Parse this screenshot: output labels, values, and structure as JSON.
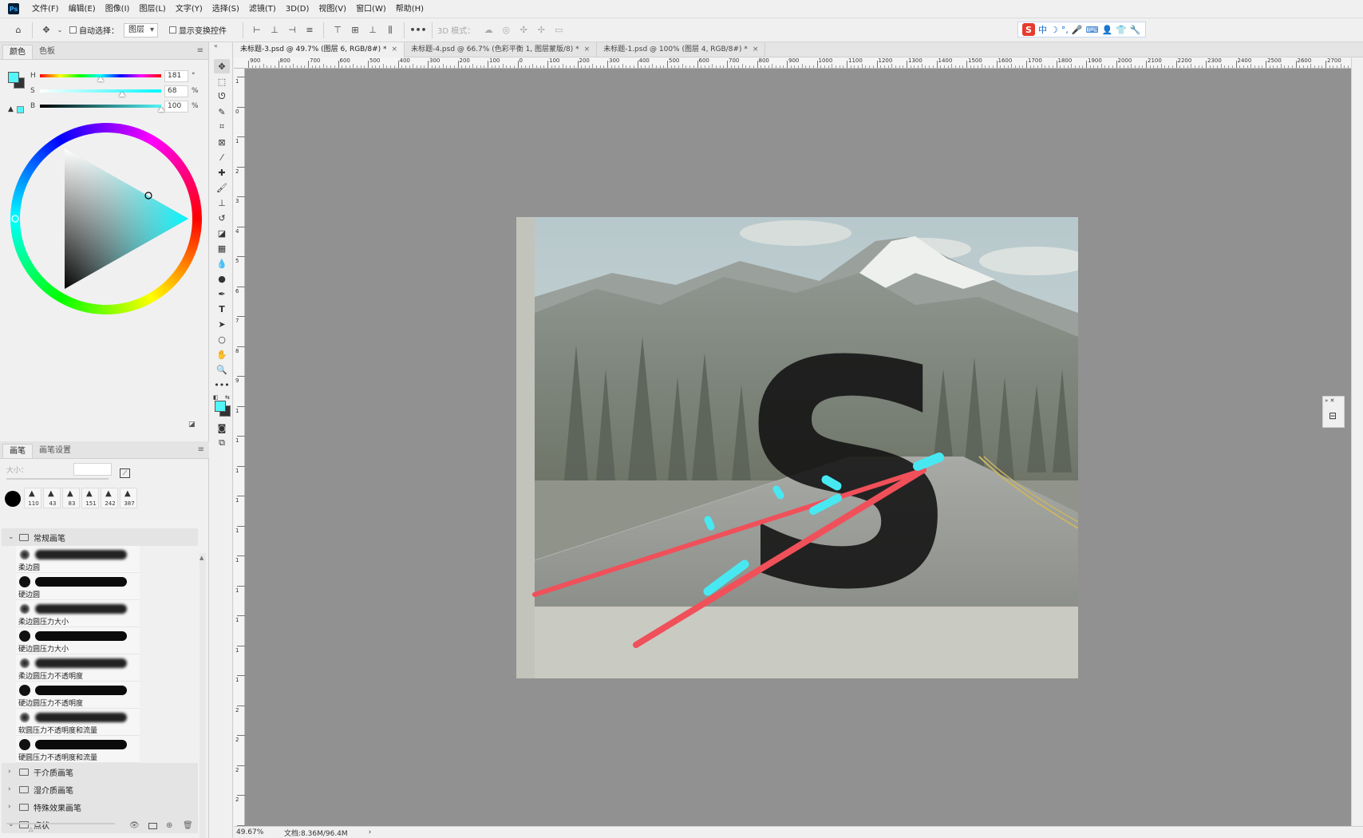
{
  "menu": {
    "items": [
      "文件(F)",
      "编辑(E)",
      "图像(I)",
      "图层(L)",
      "文字(Y)",
      "选择(S)",
      "滤镜(T)",
      "3D(D)",
      "视图(V)",
      "窗口(W)",
      "帮助(H)"
    ]
  },
  "options": {
    "auto_select_label": "自动选择：",
    "layer_select_value": "图层",
    "show_transform_label": "显示变换控件",
    "mode_3d_label": "3D 模式："
  },
  "ime": {
    "logo": "S",
    "labels": [
      "中",
      "☽",
      "°,",
      "🎤",
      "⌨",
      "👤",
      "👕",
      "🔧"
    ]
  },
  "color_panel": {
    "tabs": [
      "颜色",
      "色板"
    ],
    "h": {
      "label": "H",
      "value": "181",
      "unit": "°",
      "fraction": 0.5
    },
    "s": {
      "label": "S",
      "value": "68",
      "unit": "%",
      "fraction": 0.68
    },
    "b": {
      "label": "B",
      "value": "100",
      "unit": "%",
      "fraction": 1.0
    },
    "foreground_color": "#52f6f9",
    "background_color": "#333333"
  },
  "brush_panel": {
    "tabs": [
      "画笔",
      "画笔设置"
    ],
    "size_label": "大小：",
    "recent_sizes": [
      "110",
      "43",
      "83",
      "151",
      "242",
      "387"
    ],
    "group_open": "常规画笔",
    "brushes": [
      {
        "name": "柔边圆",
        "soft": true
      },
      {
        "name": "硬边圆",
        "soft": false
      },
      {
        "name": "柔边圆压力大小",
        "soft": true
      },
      {
        "name": "硬边圆压力大小",
        "soft": false
      },
      {
        "name": "柔边圆压力不透明度",
        "soft": true
      },
      {
        "name": "硬边圆压力不透明度",
        "soft": false
      },
      {
        "name": "软圆压力不透明度和流量",
        "soft": true
      },
      {
        "name": "硬圆压力不透明度和流量",
        "soft": false
      }
    ],
    "groups_closed": [
      "干介质画笔",
      "湿介质画笔",
      "特殊效果画笔"
    ],
    "group_last": "点状"
  },
  "documents": {
    "tabs": [
      {
        "title": "未标题-3.psd @ 49.7% (图层 6, RGB/8#) *",
        "active": true
      },
      {
        "title": "未标题-4.psd @ 66.7% (色彩平衡 1, 图层蒙版/8) *",
        "active": false
      },
      {
        "title": "未标题-1.psd @ 100% (图层 4, RGB/8#) *",
        "active": false
      }
    ]
  },
  "ruler": {
    "h_ticks": [
      "900",
      "800",
      "700",
      "600",
      "500",
      "400",
      "300",
      "200",
      "100",
      "0",
      "100",
      "200",
      "300",
      "400",
      "500",
      "600",
      "700",
      "800",
      "900",
      "1000",
      "1100",
      "1200",
      "1300",
      "1400",
      "1500",
      "1600",
      "1700",
      "1800",
      "1900",
      "2000",
      "2100",
      "2200",
      "2300",
      "2400",
      "2500",
      "2600",
      "2700"
    ],
    "v_ticks": [
      "1",
      "0",
      "1",
      "2",
      "3",
      "4",
      "5",
      "6",
      "7",
      "8",
      "9",
      "1",
      "1",
      "1",
      "1",
      "1",
      "1",
      "1",
      "1",
      "1",
      "1",
      "2",
      "2",
      "2",
      "2",
      "2"
    ]
  },
  "canvas": {
    "letter": "S",
    "stroke_red": "#f0505a",
    "stroke_cyan": "#48e8f2"
  },
  "status": {
    "zoom": "49.67%",
    "doc_size": "文档:8.36M/96.4M",
    "arrow": "›"
  }
}
